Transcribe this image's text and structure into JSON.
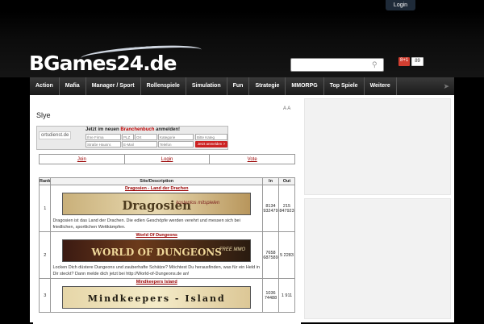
{
  "topbar": {
    "login_label": "Login"
  },
  "header": {
    "logo_text": "BGames24.de",
    "search": {
      "placeholder": ""
    },
    "gplus_label": "8+1",
    "gplus_count": "89"
  },
  "nav": {
    "items": [
      "Action",
      "Mafia",
      "Manager / Sport",
      "Rollenspiele",
      "Simulation",
      "Fun",
      "Strategie",
      "MMORPG",
      "Top Spiele",
      "Weitere"
    ]
  },
  "page": {
    "title": "Slye"
  },
  "ad": {
    "logo": "ortsdienst.de",
    "headline_prefix": "Jetzt im neuen",
    "headline_link": "Branchenbuch",
    "headline_suffix": "anmelden!",
    "fields": [
      "Ihre Firma",
      "PLZ",
      "Ort",
      "Kategorie",
      "Straße Hausnr.",
      "E-Mail",
      "Telefon"
    ],
    "select_label": "Bitte Kateg",
    "submit_label": "Jetzt anmelden >"
  },
  "links": [
    "Join",
    "Login",
    "Vote"
  ],
  "table": {
    "headers": {
      "rank": "Rank",
      "site": "Site/Description",
      "in": "In",
      "out": "Out"
    },
    "rows": [
      {
        "rank": "1",
        "name": "Dragosien - Land der Drachen",
        "banner_text": "Dragosien",
        "banner_sub": "kostenlos mitspielen",
        "description": "Dragosien ist das Land der Drachen. Die edlen Geschöpfe werden verehrt und messen sich bei friedlichen, sportlichen Wettkämpfen.",
        "in": "8134 932479",
        "out": "215 847923"
      },
      {
        "rank": "2",
        "name": "World Of Dungeons",
        "banner_text": "WORLD OF DUNGEONS",
        "banner_sub": "FREE MMO",
        "description": "Locken Dich düstere Dungeons und zauberhafte Schätze? Möchtest Du herausfinden, was für ein Held in Dir steckt? Dann melde dich jetzt bei http://World-of-Dungeons.de an!",
        "in": "7658 687589",
        "out": "5 2283"
      },
      {
        "rank": "3",
        "name": "Mindkeepers Island",
        "banner_text": "Mindkeepers - Island",
        "banner_sub": "",
        "description": "",
        "in": "1036 74488",
        "out": "1 911"
      }
    ]
  },
  "colors": {
    "accent_red": "#990000",
    "nav_bg": "#2a2a2a",
    "page_bg": "#000000"
  }
}
